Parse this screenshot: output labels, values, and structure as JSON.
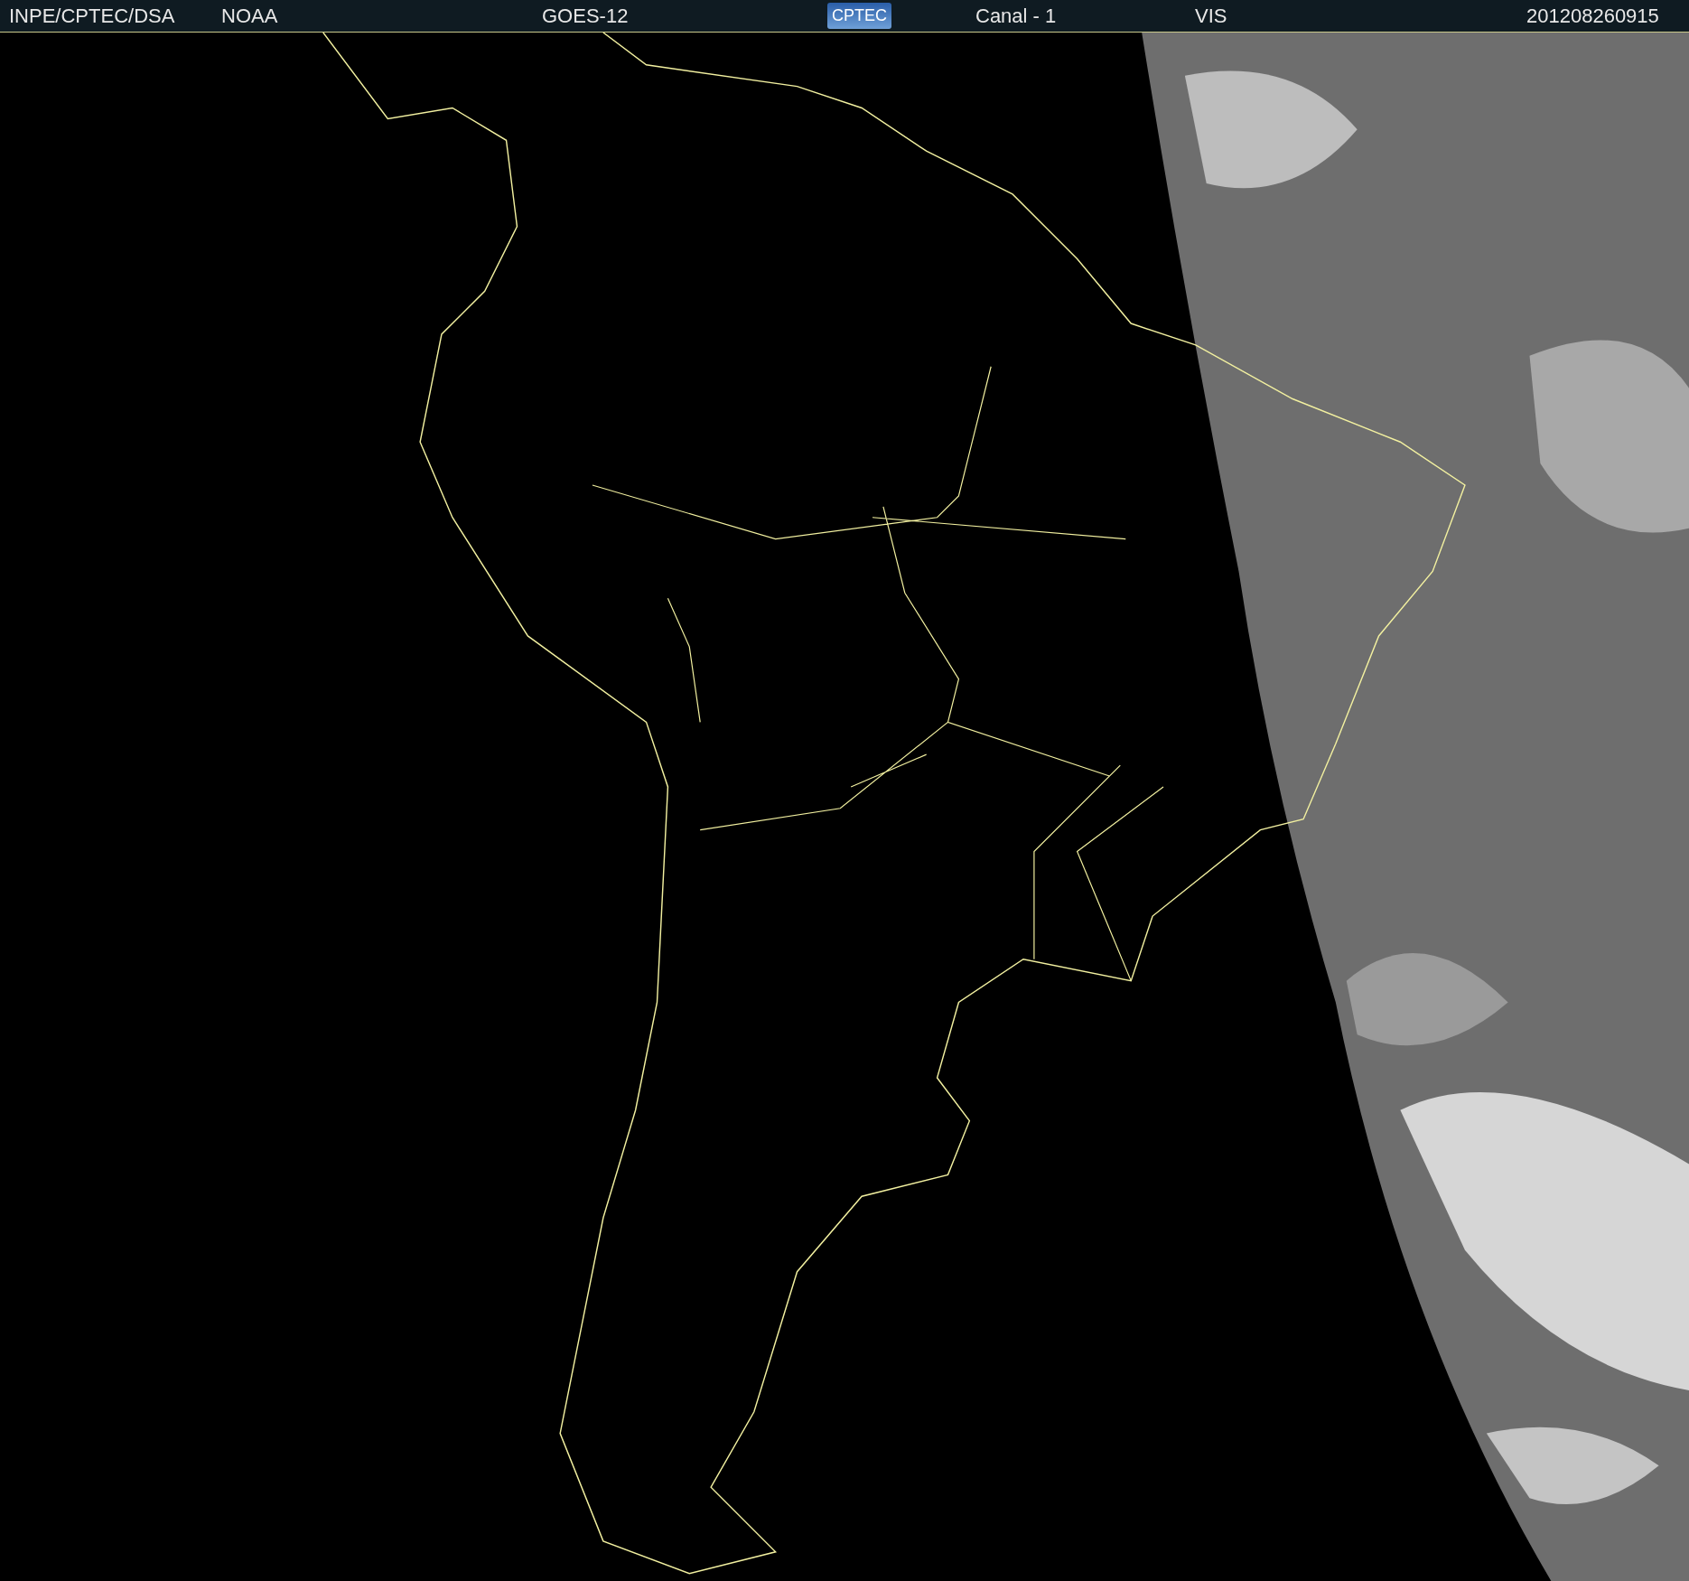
{
  "header": {
    "source": "INPE/CPTEC/DSA",
    "agency": "NOAA",
    "satellite": "GOES-12",
    "logo": "CPTEC",
    "channel": "Canal - 1",
    "band": "VIS",
    "timestamp": "201208260915"
  }
}
